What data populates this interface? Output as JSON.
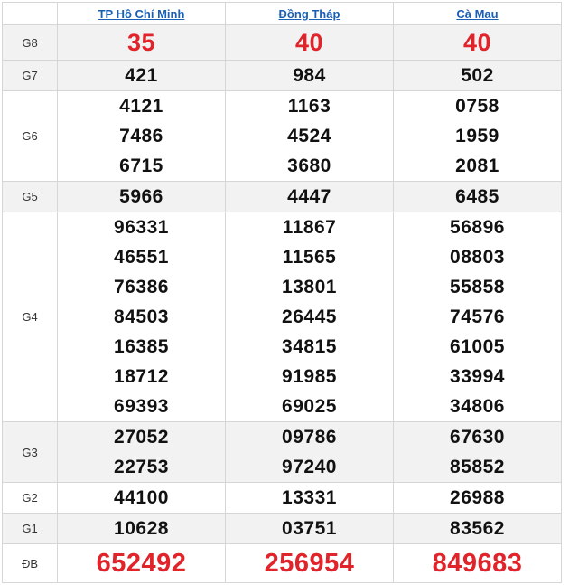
{
  "provinces": [
    "TP Hồ Chí Minh",
    "Đồng Tháp",
    "Cà Mau"
  ],
  "rows": [
    {
      "label": "G8",
      "values": [
        [
          "35"
        ],
        [
          "40"
        ],
        [
          "40"
        ]
      ]
    },
    {
      "label": "G7",
      "values": [
        [
          "421"
        ],
        [
          "984"
        ],
        [
          "502"
        ]
      ]
    },
    {
      "label": "G6",
      "values": [
        [
          "4121",
          "7486",
          "6715"
        ],
        [
          "1163",
          "4524",
          "3680"
        ],
        [
          "0758",
          "1959",
          "2081"
        ]
      ]
    },
    {
      "label": "G5",
      "values": [
        [
          "5966"
        ],
        [
          "4447"
        ],
        [
          "6485"
        ]
      ]
    },
    {
      "label": "G4",
      "values": [
        [
          "96331",
          "46551",
          "76386",
          "84503",
          "16385",
          "18712",
          "69393"
        ],
        [
          "11867",
          "11565",
          "13801",
          "26445",
          "34815",
          "91985",
          "69025"
        ],
        [
          "56896",
          "08803",
          "55858",
          "74576",
          "61005",
          "33994",
          "34806"
        ]
      ]
    },
    {
      "label": "G3",
      "values": [
        [
          "27052",
          "22753"
        ],
        [
          "09786",
          "97240"
        ],
        [
          "67630",
          "85852"
        ]
      ]
    },
    {
      "label": "G2",
      "values": [
        [
          "44100"
        ],
        [
          "13331"
        ],
        [
          "26988"
        ]
      ]
    },
    {
      "label": "G1",
      "values": [
        [
          "10628"
        ],
        [
          "03751"
        ],
        [
          "83562"
        ]
      ]
    },
    {
      "label": "ĐB",
      "values": [
        [
          "652492"
        ],
        [
          "256954"
        ],
        [
          "849683"
        ]
      ]
    }
  ],
  "colors": {
    "header_link": "#1a5fb4",
    "highlight_red": "#e0242a",
    "row_shade": "#f2f2f2",
    "border": "#d6d6d6"
  }
}
